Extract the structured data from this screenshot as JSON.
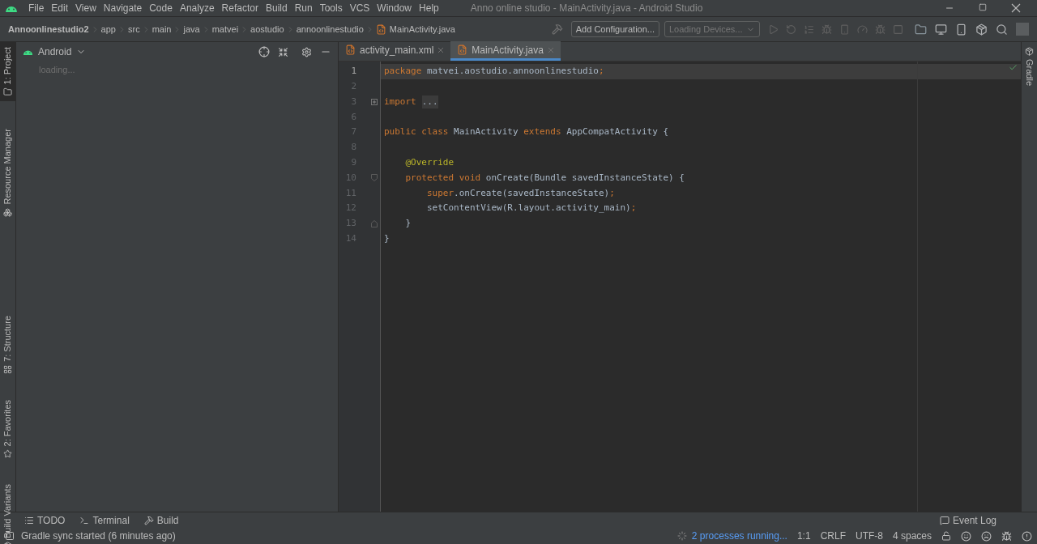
{
  "menu_bar": {
    "items": [
      "File",
      "Edit",
      "View",
      "Navigate",
      "Code",
      "Analyze",
      "Refactor",
      "Build",
      "Run",
      "Tools",
      "VCS",
      "Window",
      "Help"
    ],
    "title": "Anno online studio - MainActivity.java - Android Studio"
  },
  "breadcrumbs": [
    "Annoonlinestudio2",
    "app",
    "src",
    "main",
    "java",
    "matvei",
    "aostudio",
    "annoonlinestudio",
    "MainActivity.java"
  ],
  "toolbar": {
    "configuration": "Add Configuration...",
    "devices": "Loading Devices..."
  },
  "left_stripe": [
    {
      "label": "1: Project",
      "selected": true
    },
    {
      "label": "Resource Manager",
      "selected": false
    },
    {
      "label": "7: Structure",
      "selected": false
    },
    {
      "label": "2: Favorites",
      "selected": false
    },
    {
      "label": "Build Variants",
      "selected": false
    }
  ],
  "project_panel": {
    "view": "Android",
    "status": "loading..."
  },
  "editor_tabs": [
    {
      "label": "activity_main.xml",
      "selected": false
    },
    {
      "label": "MainActivity.java",
      "selected": true
    }
  ],
  "code_lines": [
    {
      "number": "1",
      "current": true,
      "tokens": [
        {
          "kind": "keyword",
          "text": "package"
        },
        {
          "kind": "plain",
          "text": " matvei.aostudio.annoonlinestudio"
        },
        {
          "kind": "keyword",
          "text": ";"
        }
      ]
    },
    {
      "number": "2",
      "current": false
    },
    {
      "number": "3",
      "current": false,
      "kind": "fold-collapsed",
      "tokens": [
        {
          "kind": "keyword",
          "text": "import"
        },
        {
          "kind": "folded",
          "text": "..."
        }
      ]
    },
    {
      "number": "6",
      "current": false
    },
    {
      "number": "7",
      "current": false,
      "tokens": [
        {
          "kind": "keyword",
          "text": "public class"
        },
        {
          "kind": "plain",
          "text": " MainActivity "
        },
        {
          "kind": "keyword",
          "text": "extends"
        },
        {
          "kind": "plain",
          "text": " AppCompatActivity {"
        }
      ]
    },
    {
      "number": "8",
      "current": false
    },
    {
      "number": "9",
      "current": false,
      "tokens": [
        {
          "kind": "annotation",
          "text": "    @Override"
        }
      ]
    },
    {
      "number": "10",
      "current": false,
      "kind": "fold-start",
      "tokens": [
        {
          "kind": "keyword",
          "text": "    protected void"
        },
        {
          "kind": "plain",
          "text": " onCreate(Bundle savedInstanceState) {"
        }
      ]
    },
    {
      "number": "11",
      "current": false,
      "tokens": [
        {
          "kind": "keyword",
          "text": "        super"
        },
        {
          "kind": "plain",
          "text": ".onCreate(savedInstanceState)"
        },
        {
          "kind": "keyword",
          "text": ";"
        }
      ]
    },
    {
      "number": "12",
      "current": false,
      "tokens": [
        {
          "kind": "plain",
          "text": "        setContentView(R.layout.activity_main)"
        },
        {
          "kind": "keyword",
          "text": ";"
        }
      ]
    },
    {
      "number": "13",
      "current": false,
      "kind": "fold-end",
      "tokens": [
        {
          "kind": "plain",
          "text": "    }"
        }
      ]
    },
    {
      "number": "14",
      "current": false,
      "tokens": [
        {
          "kind": "plain",
          "text": "}"
        }
      ]
    }
  ],
  "right_stripe": [
    "Gradle"
  ],
  "bottom_tabs": [
    "TODO",
    "Terminal",
    "Build"
  ],
  "event_log": "Event Log",
  "status_bar": {
    "message": "Gradle sync started (6 minutes ago)",
    "processes": "2 processes running...",
    "position": "1:1",
    "line_separator": "CRLF",
    "encoding": "UTF-8",
    "indent": "4 spaces"
  }
}
